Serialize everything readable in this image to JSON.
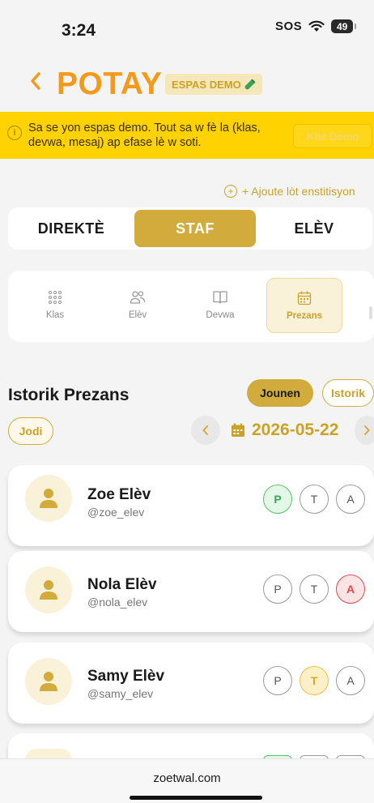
{
  "status_bar": {
    "time": "3:24",
    "sos": "SOS",
    "battery": "49"
  },
  "header": {
    "back_icon": "chevron-left-icon",
    "title": "POTAY",
    "badge": "ESPAS DEMO"
  },
  "banner": {
    "text": "Sa se yon espas demo. Tout sa w fè la (klas, devwa, mesaj) ap efase lè w soti.",
    "button": "Kite Demo"
  },
  "add_institution": "+ Ajoute lòt enstitisyon",
  "role_tabs": [
    {
      "label": "DIREKTÈ",
      "active": false
    },
    {
      "label": "STAF",
      "active": true
    },
    {
      "label": "ELÈV",
      "active": false
    }
  ],
  "subnav": [
    {
      "label": "Klas",
      "icon": "grid-icon",
      "active": false
    },
    {
      "label": "Elèv",
      "icon": "users-icon",
      "active": false
    },
    {
      "label": "Devwa",
      "icon": "book-icon",
      "active": false
    },
    {
      "label": "Prezans",
      "icon": "calendar-icon",
      "active": true
    }
  ],
  "history": {
    "title": "Istorik Prezans",
    "today_label": "Jounen",
    "history_label": "Istorik",
    "today_button": "Jodi",
    "date": "2026-05-22"
  },
  "students": [
    {
      "name": "Zoe Elèv",
      "handle": "@zoe_elev",
      "status": "P"
    },
    {
      "name": "Nola Elèv",
      "handle": "@nola_elev",
      "status": "A"
    },
    {
      "name": "Samy Elèv",
      "handle": "@samy_elev",
      "status": "T"
    }
  ],
  "attendance_labels": [
    "P",
    "T",
    "A"
  ],
  "footer": {
    "url": "zoetwal.com"
  },
  "colors": {
    "accent": "#d1ab3b",
    "title_orange": "#f39a1b",
    "banner_yellow": "#ffd200"
  }
}
